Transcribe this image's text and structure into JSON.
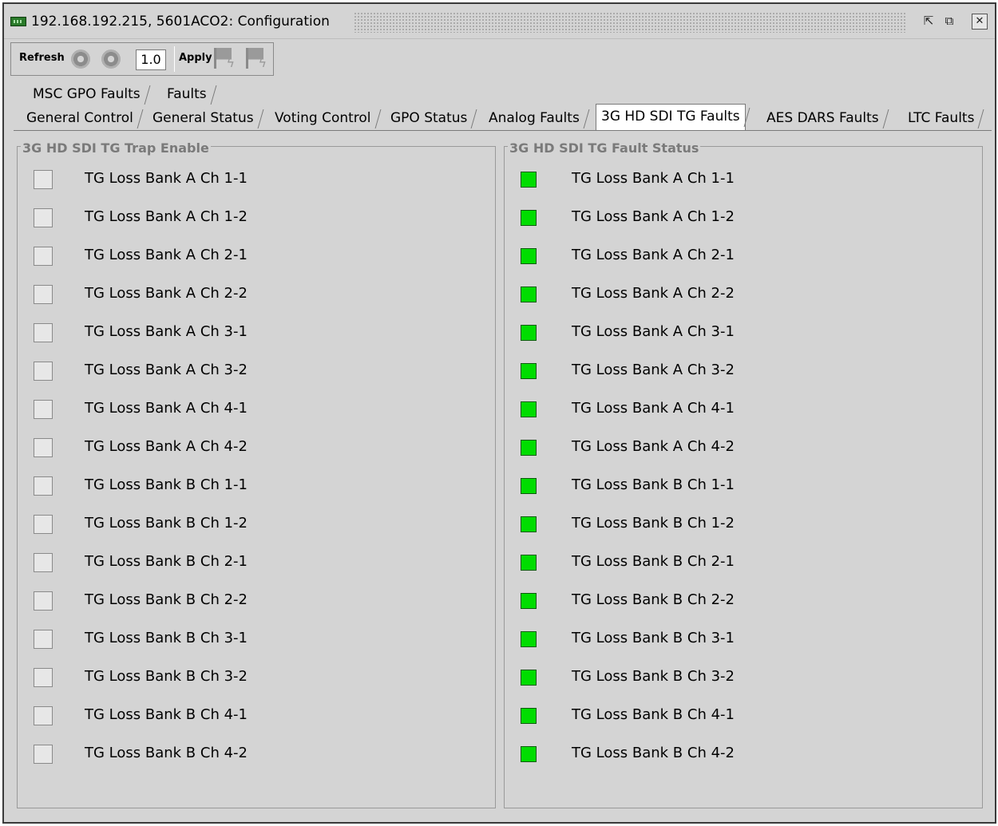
{
  "window": {
    "title": "192.168.192.215, 5601ACO2: Configuration",
    "title_icon": "device-card-icon",
    "controls": [
      "detach-icon",
      "maximize-icon",
      "close-icon"
    ]
  },
  "toolbar": {
    "refresh_label": "Refresh",
    "value": "1.0",
    "apply_label": "Apply"
  },
  "tabs_row1": [
    "MSC GPO Faults",
    "Faults"
  ],
  "tabs_row2": [
    "General Control",
    "General Status",
    "Voting Control",
    "GPO Status",
    "Analog Faults",
    "3G HD SDI TG Faults",
    "AES DARS Faults",
    "LTC Faults"
  ],
  "active_tab": "3G HD SDI TG Faults",
  "trap_enable": {
    "title": "3G HD SDI TG Trap Enable",
    "items": [
      {
        "label": "TG Loss Bank A Ch 1-1",
        "checked": false
      },
      {
        "label": "TG Loss Bank A Ch 1-2",
        "checked": false
      },
      {
        "label": "TG Loss Bank A Ch 2-1",
        "checked": false
      },
      {
        "label": "TG Loss Bank A Ch 2-2",
        "checked": false
      },
      {
        "label": "TG Loss Bank A Ch 3-1",
        "checked": false
      },
      {
        "label": "TG Loss Bank A Ch 3-2",
        "checked": false
      },
      {
        "label": "TG Loss Bank A Ch 4-1",
        "checked": false
      },
      {
        "label": "TG Loss Bank A Ch 4-2",
        "checked": false
      },
      {
        "label": "TG Loss Bank B Ch 1-1",
        "checked": false
      },
      {
        "label": "TG Loss Bank B Ch 1-2",
        "checked": false
      },
      {
        "label": "TG Loss Bank B Ch 2-1",
        "checked": false
      },
      {
        "label": "TG Loss Bank B Ch 2-2",
        "checked": false
      },
      {
        "label": "TG Loss Bank B Ch 3-1",
        "checked": false
      },
      {
        "label": "TG Loss Bank B Ch 3-2",
        "checked": false
      },
      {
        "label": "TG Loss Bank B Ch 4-1",
        "checked": false
      },
      {
        "label": "TG Loss Bank B Ch 4-2",
        "checked": false
      }
    ]
  },
  "fault_status": {
    "title": "3G HD SDI TG Fault Status",
    "status_color": "#00dd00",
    "items": [
      {
        "label": "TG Loss Bank A Ch 1-1",
        "status": "ok"
      },
      {
        "label": "TG Loss Bank A Ch 1-2",
        "status": "ok"
      },
      {
        "label": "TG Loss Bank A Ch 2-1",
        "status": "ok"
      },
      {
        "label": "TG Loss Bank A Ch 2-2",
        "status": "ok"
      },
      {
        "label": "TG Loss Bank A Ch 3-1",
        "status": "ok"
      },
      {
        "label": "TG Loss Bank A Ch 3-2",
        "status": "ok"
      },
      {
        "label": "TG Loss Bank A Ch 4-1",
        "status": "ok"
      },
      {
        "label": "TG Loss Bank A Ch 4-2",
        "status": "ok"
      },
      {
        "label": "TG Loss Bank B Ch 1-1",
        "status": "ok"
      },
      {
        "label": "TG Loss Bank B Ch 1-2",
        "status": "ok"
      },
      {
        "label": "TG Loss Bank B Ch 2-1",
        "status": "ok"
      },
      {
        "label": "TG Loss Bank B Ch 2-2",
        "status": "ok"
      },
      {
        "label": "TG Loss Bank B Ch 3-1",
        "status": "ok"
      },
      {
        "label": "TG Loss Bank B Ch 3-2",
        "status": "ok"
      },
      {
        "label": "TG Loss Bank B Ch 4-1",
        "status": "ok"
      },
      {
        "label": "TG Loss Bank B Ch 4-2",
        "status": "ok"
      }
    ]
  }
}
